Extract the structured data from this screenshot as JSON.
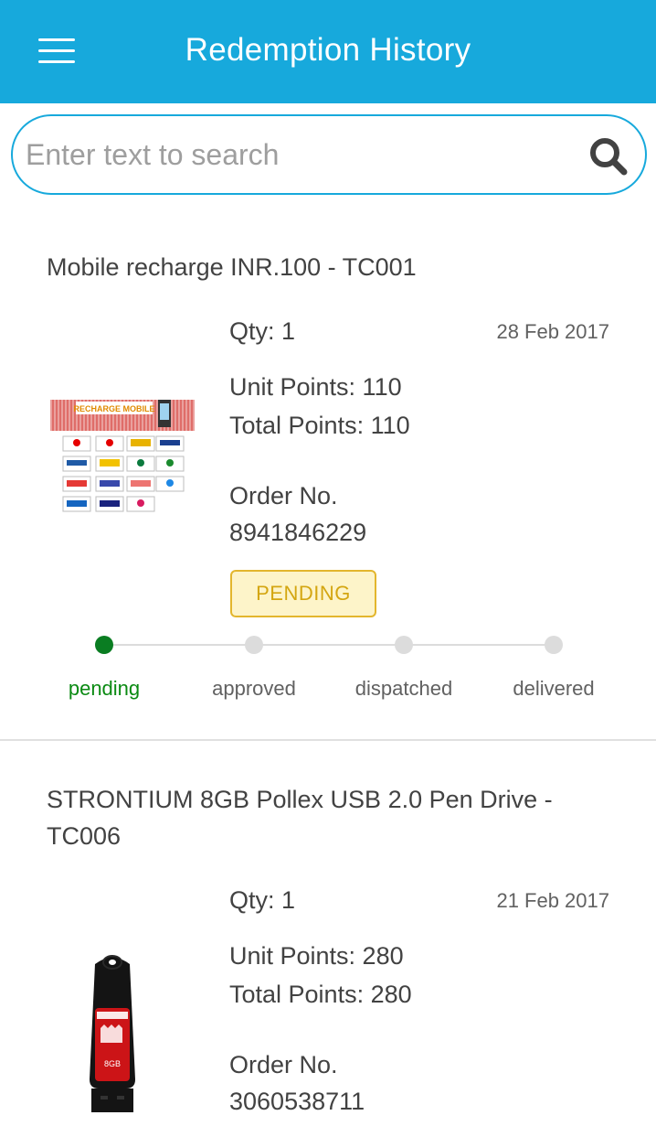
{
  "header": {
    "title": "Redemption History"
  },
  "search": {
    "placeholder": "Enter text to search"
  },
  "orders": [
    {
      "title": "Mobile recharge INR.100 - TC001",
      "qty": "Qty: 1",
      "date": "28 Feb 2017",
      "unit_points": "Unit Points: 110",
      "total_points": "Total Points: 110",
      "order_label": "Order No.",
      "order_no": "8941846229",
      "status": "PENDING",
      "image_text": "RECHARGE MOBILE",
      "steps": [
        "pending",
        "approved",
        "dispatched",
        "delivered"
      ],
      "current_step": "pending"
    },
    {
      "title": "STRONTIUM 8GB Pollex USB 2.0 Pen Drive - TC006",
      "qty": "Qty: 1",
      "date": "21 Feb 2017",
      "unit_points": "Unit Points: 280",
      "total_points": "Total Points: 280",
      "order_label": "Order No.",
      "order_no": "3060538711",
      "image_text": "8GB"
    }
  ],
  "colors": {
    "accent": "#17a9dc",
    "pending_badge": "#e3b62d",
    "active_step": "#0a7d22"
  },
  "icons": {
    "menu": "hamburger-menu-icon",
    "search": "search-icon"
  }
}
